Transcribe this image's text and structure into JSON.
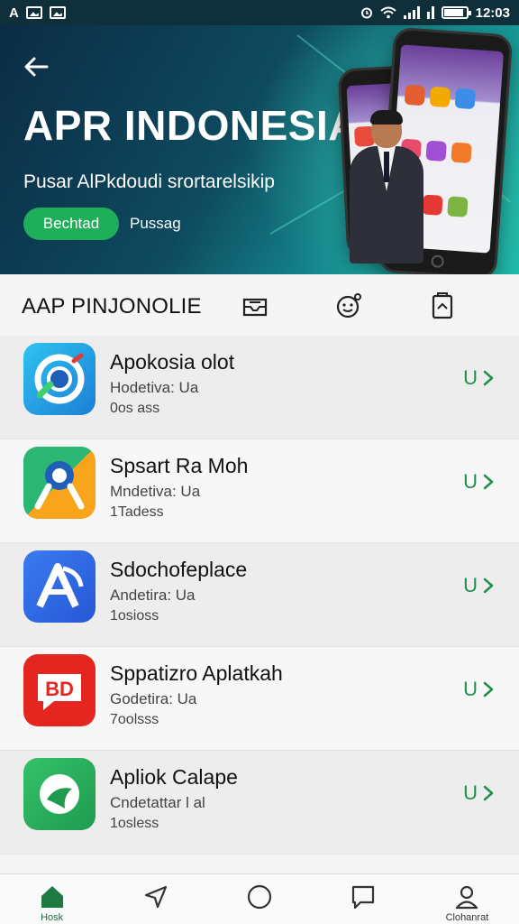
{
  "status_bar": {
    "left_text": "A",
    "time": "12:03"
  },
  "hero": {
    "title": "APR INDONESIA",
    "subtitle": "Pusar AlPkdoudi srortarelsikip",
    "primary_button": "Bechtad",
    "secondary_link": "Pussag",
    "accent_color": "#1fae5a"
  },
  "section": {
    "title": "AAP PINJONOLIE",
    "icons": [
      "inbox-icon",
      "chat-face-icon",
      "clipboard-icon"
    ]
  },
  "apps": [
    {
      "name": "Apokosia olot",
      "developer": "Hodetiva: Ua",
      "size": "0os ass",
      "action": "U",
      "icon": "target-icon"
    },
    {
      "name": "Spsart Ra Moh",
      "developer": "Mndetiva: Ua",
      "size": "1Tadess",
      "action": "U",
      "icon": "person-pin-icon"
    },
    {
      "name": "Sdochofeplace",
      "developer": "Andetira: Ua",
      "size": "1osioss",
      "action": "U",
      "icon": "letter-a-icon"
    },
    {
      "name": "Sppatizro Aplatkah",
      "developer": "Godetira: Ua",
      "size": "7oolsss",
      "action": "U",
      "icon": "video-badge-icon"
    },
    {
      "name": "Apliok Calape",
      "developer": "Cndetattar l al",
      "size": "1osless",
      "action": "U",
      "icon": "swirl-icon"
    }
  ],
  "bottom_nav": [
    {
      "label": "Hosk",
      "icon": "home-icon",
      "active": true
    },
    {
      "label": "",
      "icon": "send-icon",
      "active": false
    },
    {
      "label": "",
      "icon": "circle-icon",
      "active": false
    },
    {
      "label": "",
      "icon": "message-icon",
      "active": false
    },
    {
      "label": "Clohanrat",
      "icon": "profile-icon",
      "active": false
    }
  ]
}
